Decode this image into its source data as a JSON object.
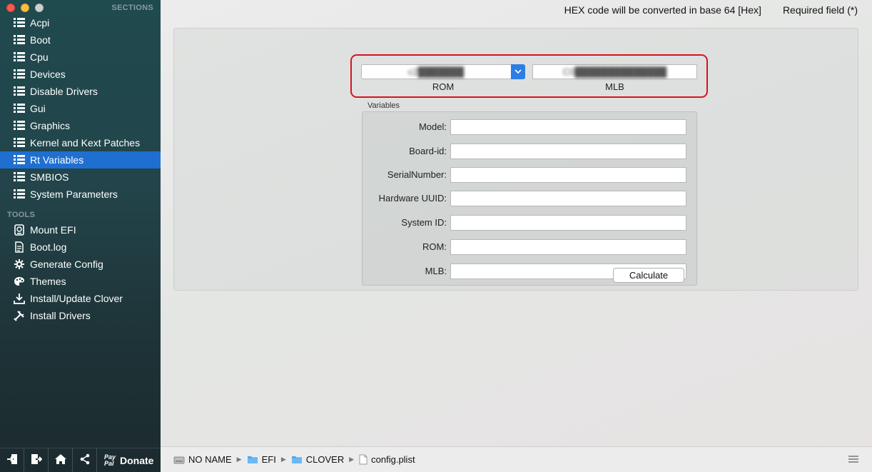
{
  "sidebar": {
    "sections_header": "SECTIONS",
    "tools_header": "TOOLS",
    "sections": [
      {
        "label": "Acpi"
      },
      {
        "label": "Boot"
      },
      {
        "label": "Cpu"
      },
      {
        "label": "Devices"
      },
      {
        "label": "Disable Drivers"
      },
      {
        "label": "Gui"
      },
      {
        "label": "Graphics"
      },
      {
        "label": "Kernel and Kext Patches"
      },
      {
        "label": "Rt Variables"
      },
      {
        "label": "SMBIOS"
      },
      {
        "label": "System Parameters"
      }
    ],
    "tools": [
      {
        "label": "Mount EFI"
      },
      {
        "label": "Boot.log"
      },
      {
        "label": "Generate Config"
      },
      {
        "label": "Themes"
      },
      {
        "label": "Install/Update Clover"
      },
      {
        "label": "Install Drivers"
      }
    ],
    "donate_label": "Donate",
    "paypal_top": "Pay",
    "paypal_bottom": "Pal"
  },
  "header": {
    "hex_note": "HEX code will be converted in base 64 [Hex]",
    "required_note": "Required field (*)"
  },
  "rom_selector": {
    "value": "c2███████",
    "caption": "ROM"
  },
  "mlb_field": {
    "value": "C0██████████████",
    "caption": "MLB"
  },
  "variables": {
    "group_label": "Variables",
    "fields": [
      {
        "label": "Model:",
        "value": ""
      },
      {
        "label": "Board-id:",
        "value": ""
      },
      {
        "label": "SerialNumber:",
        "value": ""
      },
      {
        "label": "Hardware UUID:",
        "value": ""
      },
      {
        "label": "System ID:",
        "value": ""
      },
      {
        "label": "ROM:",
        "value": ""
      },
      {
        "label": "MLB:",
        "value": ""
      }
    ]
  },
  "calculate_label": "Calculate",
  "path_bar": {
    "items": [
      "NO NAME",
      "EFI",
      "CLOVER",
      "config.plist"
    ]
  },
  "colors": {
    "accent": "#1f6fd1",
    "highlight_border": "#d8131f",
    "folder": "#4aa3f0"
  }
}
